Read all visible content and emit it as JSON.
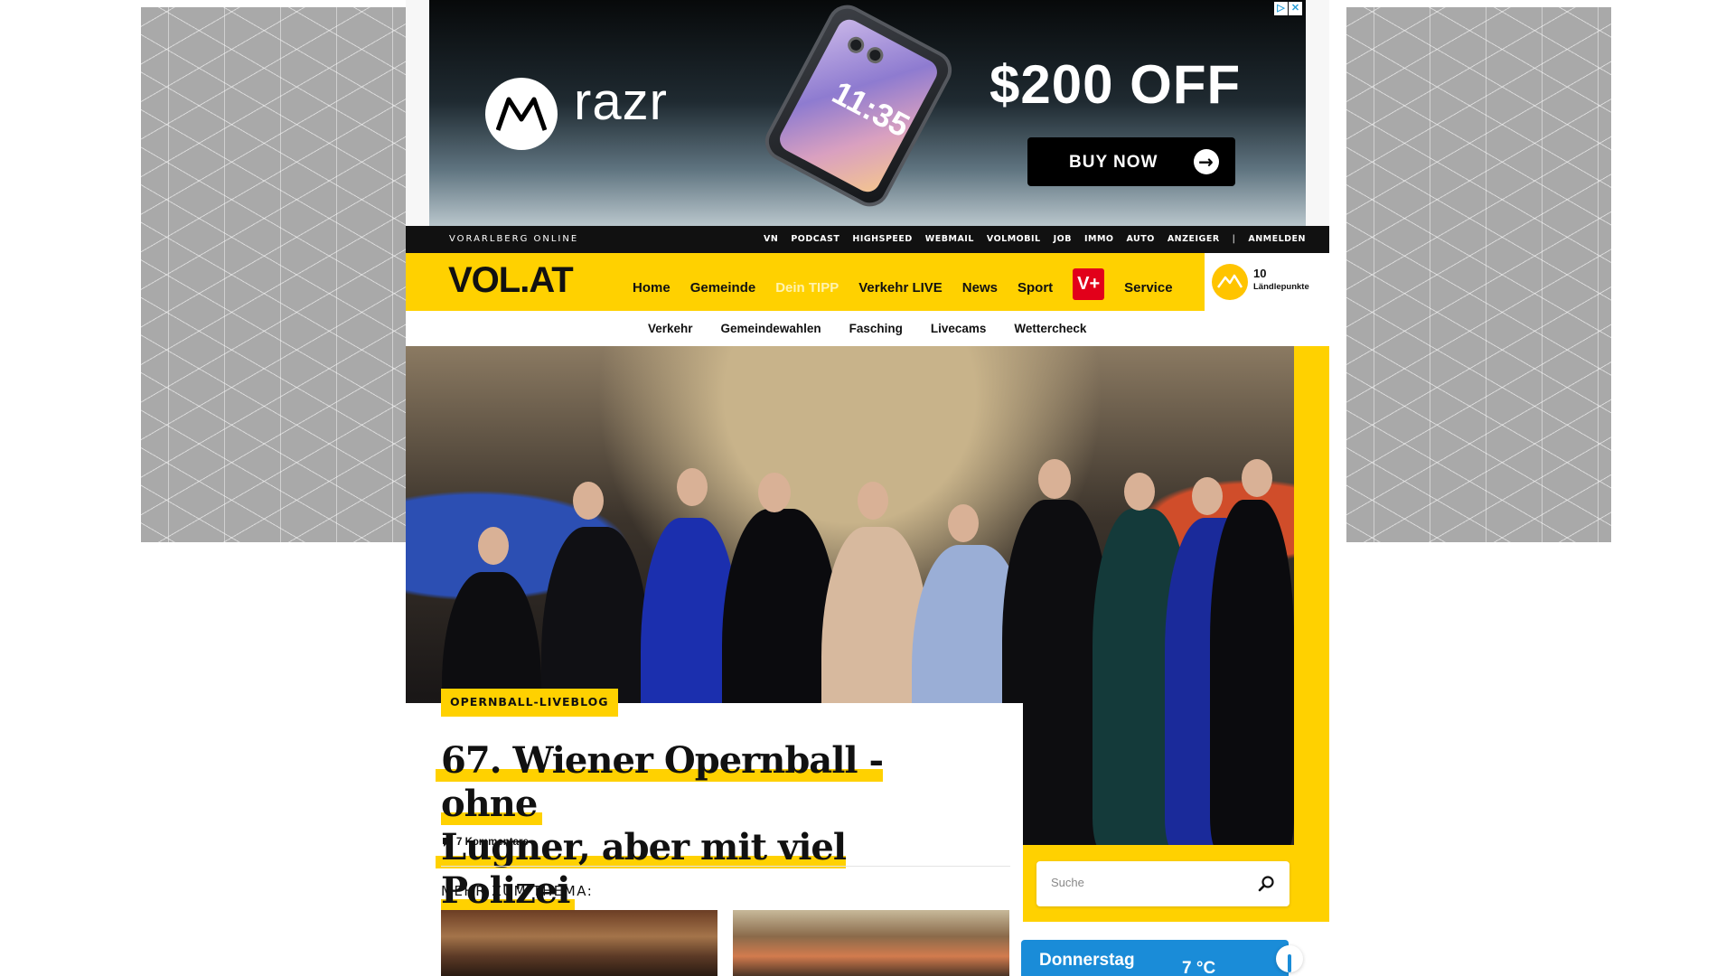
{
  "ad": {
    "brand": "razr",
    "offer": "$200 OFF",
    "cta": "BUY NOW",
    "phone_time": "11:35",
    "badge_info": "▷",
    "badge_close": "✕"
  },
  "topbar": {
    "site_name": "VORARLBERG ONLINE",
    "links": [
      "VN",
      "PODCAST",
      "HIGHSPEED",
      "WEBMAIL",
      "VOLMOBIL",
      "JOB",
      "IMMO",
      "AUTO",
      "ANZEIGER",
      "ANMELDEN"
    ],
    "separator": "|"
  },
  "header": {
    "logo": "VOL.AT",
    "nav": [
      "Home",
      "Gemeinde",
      "Dein TIPP",
      "Verkehr LIVE",
      "News",
      "Sport",
      "V+",
      "Service"
    ],
    "points_value": "10",
    "points_label": "Ländlepunkte"
  },
  "subnav": [
    "Verkehr",
    "Gemeindewahlen",
    "Fasching",
    "Livecams",
    "Wettercheck"
  ],
  "article": {
    "tag": "OPERNBALL-LIVEBLOG",
    "headline_line1": "67. Wiener Opernball - ohne",
    "headline_line2": "Lugner, aber mit viel Polizei",
    "comments": "7 Kommentare",
    "related_heading": "MEHR ZUM THEMA:"
  },
  "search": {
    "placeholder": "Suche"
  },
  "weather": {
    "day": "Donnerstag",
    "temp": "7 °C"
  },
  "colors": {
    "brand_yellow": "#ffd100",
    "vplus_red": "#e2001a",
    "weather_blue": "#1a8cd8"
  }
}
